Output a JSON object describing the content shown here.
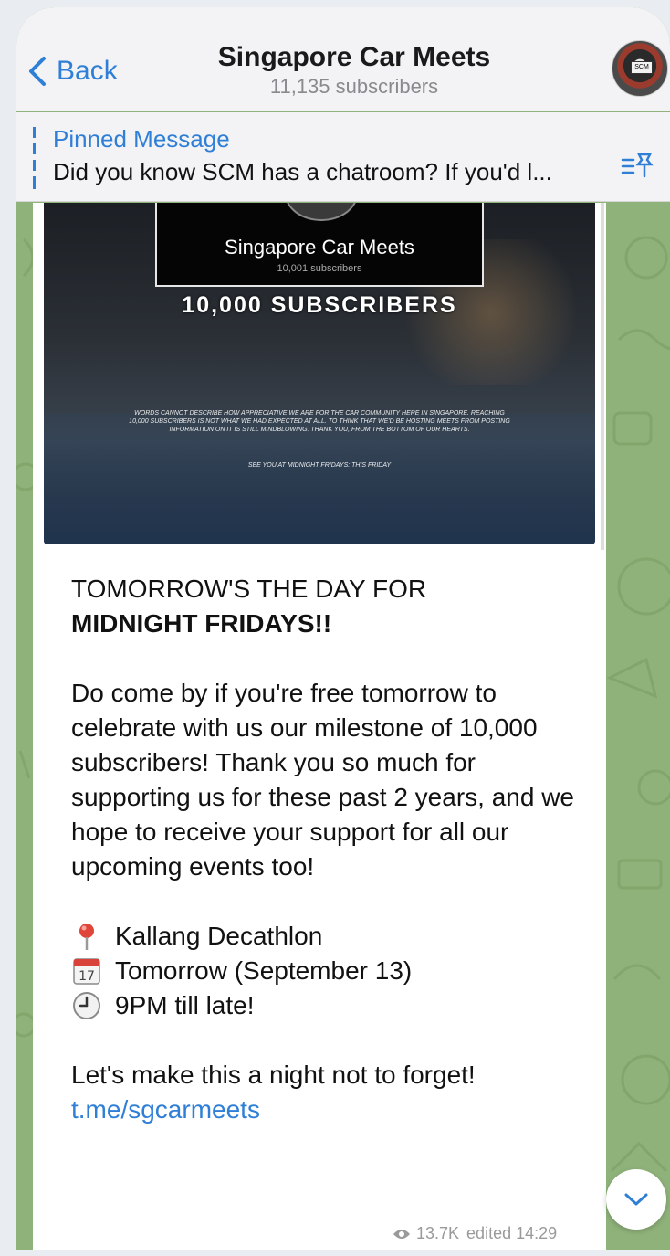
{
  "header": {
    "back_label": "Back",
    "title": "Singapore Car Meets",
    "subtitle": "11,135 subscribers",
    "avatar_plate": "SCM"
  },
  "pinned": {
    "label": "Pinned Message",
    "text": "Did you know SCM has a chatroom? If you'd l..."
  },
  "media": {
    "box_title": "Singapore Car Meets",
    "box_subtitle": "10,001 subscribers",
    "banner": "10,000 SUBSCRIBERS",
    "small_text": "WORDS CANNOT DESCRIBE HOW APPRECIATIVE WE ARE FOR THE CAR COMMUNITY HERE IN SINGAPORE. REACHING 10,000 SUBSCRIBERS IS NOT WHAT WE HAD EXPECTED AT ALL. TO THINK THAT WE'D BE HOSTING MEETS FROM POSTING INFORMATION ON IT IS STILL MINDBLOWING. THANK YOU, FROM THE BOTTOM OF OUR HEARTS.",
    "small_cta": "SEE YOU AT MIDNIGHT FRIDAYS: THIS FRIDAY"
  },
  "message": {
    "headline_line1": "TOMORROW'S THE DAY FOR",
    "headline_line2": "MIDNIGHT FRIDAYS!!",
    "body": "Do come by if you're free tomorrow to celebrate with us our milestone of 10,000 subscribers! Thank you so much for supporting us for these past 2 years, and we hope to receive your support for all our upcoming events too!",
    "location": "Kallang Decathlon",
    "date": "Tomorrow (September 13)",
    "time": "9PM till late!",
    "closing": "Let's make this a night not to forget!",
    "link": "t.me/sgcarmeets",
    "calendar_day": "17"
  },
  "meta": {
    "views": "13.7K",
    "edited": "edited 14:29"
  },
  "icons": {
    "back": "chevron-left-icon",
    "pin_list": "pin-list-icon",
    "location": "pin-icon",
    "calendar": "calendar-icon",
    "clock": "clock-icon",
    "views": "eye-icon",
    "scroll_down": "chevron-down-icon"
  },
  "colors": {
    "accent": "#2f7fd6",
    "chat_background": "#8fb27a",
    "bubble": "#ffffff"
  }
}
